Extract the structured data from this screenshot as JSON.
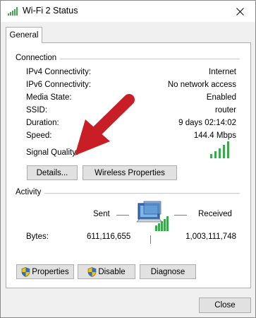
{
  "window": {
    "title": "Wi-Fi 2 Status"
  },
  "tabs": [
    {
      "label": "General"
    }
  ],
  "connection": {
    "group_label": "Connection",
    "rows": [
      {
        "label": "IPv4 Connectivity:",
        "value": "Internet"
      },
      {
        "label": "IPv6 Connectivity:",
        "value": "No network access"
      },
      {
        "label": "Media State:",
        "value": "Enabled"
      },
      {
        "label": "SSID:",
        "value": "router"
      },
      {
        "label": "Duration:",
        "value": "9 days 02:14:02"
      },
      {
        "label": "Speed:",
        "value": "144.4 Mbps"
      }
    ],
    "signal_label": "Signal Quality:",
    "signal_bars_lit": 5,
    "signal_bars_total": 5,
    "details_button": "Details...",
    "wireless_button": "Wireless Properties"
  },
  "activity": {
    "group_label": "Activity",
    "sent_label": "Sent",
    "received_label": "Received",
    "bytes_label": "Bytes:",
    "bytes_sent": "611,116,655",
    "bytes_received": "1,003,111,748",
    "network_icon": "network-computer-icon"
  },
  "actions": {
    "properties_button": "Properties",
    "disable_button": "Disable",
    "diagnose_button": "Diagnose"
  },
  "footer": {
    "close_button": "Close"
  },
  "colors": {
    "signal_green": "#3aa84b",
    "annotation_arrow": "#d0202a",
    "button_face": "#e1e1e1",
    "window_bg": "#f0f0f0"
  }
}
